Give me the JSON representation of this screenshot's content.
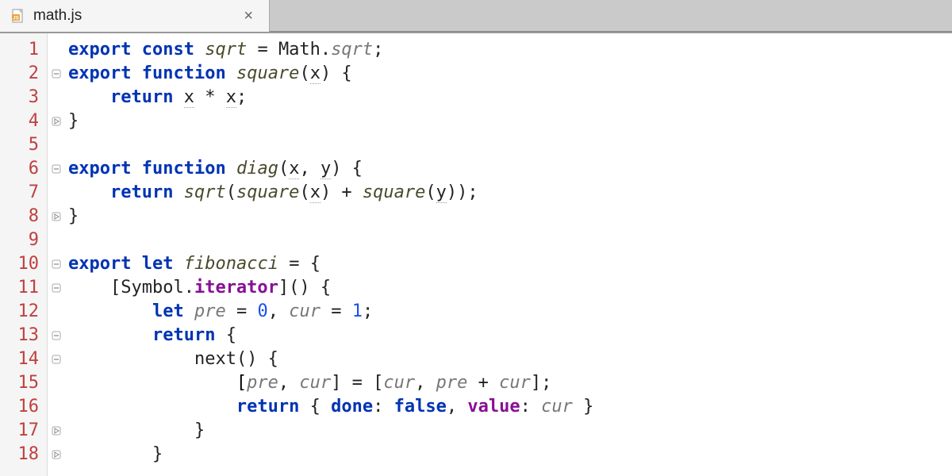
{
  "tab": {
    "filename": "math.js",
    "close_symbol": "×"
  },
  "gutter": {
    "lines": [
      "1",
      "2",
      "3",
      "4",
      "5",
      "6",
      "7",
      "8",
      "9",
      "10",
      "11",
      "12",
      "13",
      "14",
      "15",
      "16",
      "17",
      "18"
    ]
  },
  "fold": {
    "markers": [
      "",
      "open",
      "",
      "close",
      "",
      "open",
      "",
      "close",
      "",
      "open",
      "open",
      "",
      "open",
      "open",
      "",
      "",
      "close",
      "close"
    ]
  },
  "code": {
    "l1": {
      "t1": "export",
      "t2": " ",
      "t3": "const",
      "t4": " ",
      "t5": "sqrt",
      "t6": " = Math.",
      "t7": "sqrt",
      "t8": ";"
    },
    "l2": {
      "t1": "export",
      "t2": " ",
      "t3": "function",
      "t4": " ",
      "t5": "square",
      "t6": "(",
      "t7": "x",
      "t8": ") {"
    },
    "l3": {
      "t1": "    ",
      "t2": "return",
      "t3": " ",
      "t4": "x",
      "t5": " * ",
      "t6": "x",
      "t7": ";"
    },
    "l4": {
      "t1": "}"
    },
    "l5": {
      "t1": ""
    },
    "l6": {
      "t1": "export",
      "t2": " ",
      "t3": "function",
      "t4": " ",
      "t5": "diag",
      "t6": "(",
      "t7": "x",
      "t8": ", ",
      "t9": "y",
      "t10": ") {"
    },
    "l7": {
      "t1": "    ",
      "t2": "return",
      "t3": " ",
      "t4": "sqrt",
      "t5": "(",
      "t6": "square",
      "t7": "(",
      "t8": "x",
      "t9": ") + ",
      "t10": "square",
      "t11": "(",
      "t12": "y",
      "t13": "));"
    },
    "l8": {
      "t1": "}"
    },
    "l9": {
      "t1": ""
    },
    "l10": {
      "t1": "export",
      "t2": " ",
      "t3": "let",
      "t4": " ",
      "t5": "fibonacci",
      "t6": " = {"
    },
    "l11": {
      "t1": "    [Symbol.",
      "t2": "iterator",
      "t3": "]() {"
    },
    "l12": {
      "t1": "        ",
      "t2": "let",
      "t3": " ",
      "t4": "pre",
      "t5": " = ",
      "t6": "0",
      "t7": ", ",
      "t8": "cur",
      "t9": " = ",
      "t10": "1",
      "t11": ";"
    },
    "l13": {
      "t1": "        ",
      "t2": "return",
      "t3": " {"
    },
    "l14": {
      "t1": "            ",
      "t2": "next",
      "t3": "() {"
    },
    "l15": {
      "t1": "                [",
      "t2": "pre",
      "t3": ", ",
      "t4": "cur",
      "t5": "] = [",
      "t6": "cur",
      "t7": ", ",
      "t8": "pre",
      "t9": " + ",
      "t10": "cur",
      "t11": "];"
    },
    "l16": {
      "t1": "                ",
      "t2": "return",
      "t3": " { ",
      "t4": "done",
      "t5": ": ",
      "t6": "false",
      "t7": ", ",
      "t8": "value",
      "t9": ": ",
      "t10": "cur",
      "t11": " }"
    },
    "l17": {
      "t1": "            }"
    },
    "l18": {
      "t1": "        }"
    }
  }
}
